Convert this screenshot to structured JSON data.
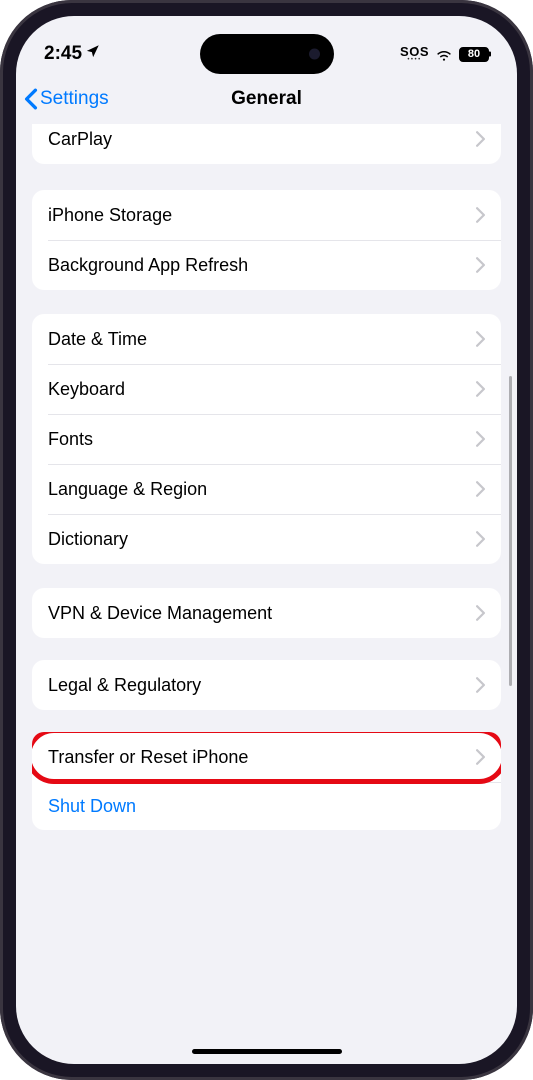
{
  "status": {
    "time": "2:45",
    "sos": "SOS",
    "battery": "80"
  },
  "nav": {
    "back": "Settings",
    "title": "General"
  },
  "groups": {
    "carplay": {
      "label": "CarPlay"
    },
    "storage": {
      "items": [
        {
          "label": "iPhone Storage"
        },
        {
          "label": "Background App Refresh"
        }
      ]
    },
    "prefs": {
      "items": [
        {
          "label": "Date & Time"
        },
        {
          "label": "Keyboard"
        },
        {
          "label": "Fonts"
        },
        {
          "label": "Language & Region"
        },
        {
          "label": "Dictionary"
        }
      ]
    },
    "vpn": {
      "label": "VPN & Device Management"
    },
    "legal": {
      "label": "Legal & Regulatory"
    },
    "reset": {
      "transfer_label": "Transfer or Reset iPhone",
      "shutdown_label": "Shut Down"
    }
  }
}
